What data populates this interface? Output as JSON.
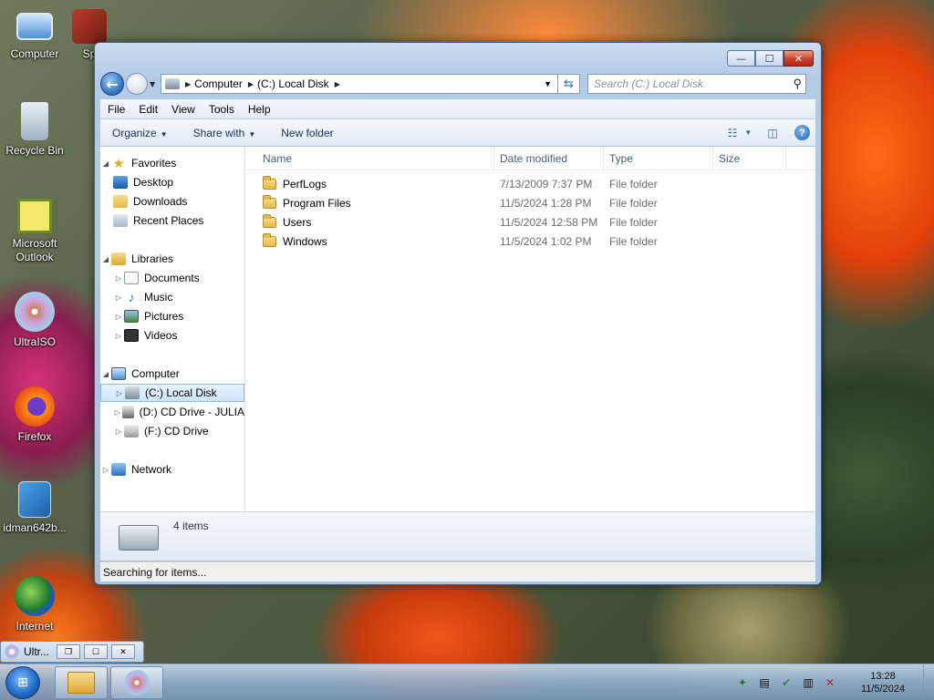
{
  "desktop": {
    "icons": [
      {
        "label": "Computer"
      },
      {
        "label": "Sp"
      },
      {
        "label": "Recycle Bin"
      },
      {
        "label": "Microsoft Outlook"
      },
      {
        "label": "UltraISO"
      },
      {
        "label": "Firefox"
      },
      {
        "label": "idman642b..."
      },
      {
        "label": "Internet"
      }
    ]
  },
  "window": {
    "caption_buttons": {
      "minimize": "—",
      "maximize": "☐",
      "close": "✕"
    },
    "address": {
      "segments": [
        "Computer",
        "(C:) Local Disk"
      ]
    },
    "search_placeholder": "Search (C:) Local Disk",
    "menu": [
      "File",
      "Edit",
      "View",
      "Tools",
      "Help"
    ],
    "commands": {
      "organize": "Organize",
      "share_with": "Share with",
      "new_folder": "New folder"
    },
    "nav": {
      "favorites": "Favorites",
      "desktop": "Desktop",
      "downloads": "Downloads",
      "recent_places": "Recent Places",
      "libraries": "Libraries",
      "documents": "Documents",
      "music": "Music",
      "pictures": "Pictures",
      "videos": "Videos",
      "computer": "Computer",
      "c_drive": "(C:) Local Disk",
      "d_drive": "(D:) CD Drive - JULIA",
      "f_drive": "(F:) CD Drive",
      "network": "Network"
    },
    "columns": {
      "name": "Name",
      "date": "Date modified",
      "type": "Type",
      "size": "Size"
    },
    "files": [
      {
        "name": "PerfLogs",
        "date": "7/13/2009 7:37 PM",
        "type": "File folder"
      },
      {
        "name": "Program Files",
        "date": "11/5/2024 1:28 PM",
        "type": "File folder"
      },
      {
        "name": "Users",
        "date": "11/5/2024 12:58 PM",
        "type": "File folder"
      },
      {
        "name": "Windows",
        "date": "11/5/2024 1:02 PM",
        "type": "File folder"
      }
    ],
    "details_count": "4 items",
    "status": "Searching for items..."
  },
  "taskbar": {
    "mini_label": "Ultr...",
    "clock_time": "13:28",
    "clock_date": "11/5/2024"
  },
  "colors": {
    "accent": "#2a6fc0",
    "selection": "#cfe4fa"
  }
}
